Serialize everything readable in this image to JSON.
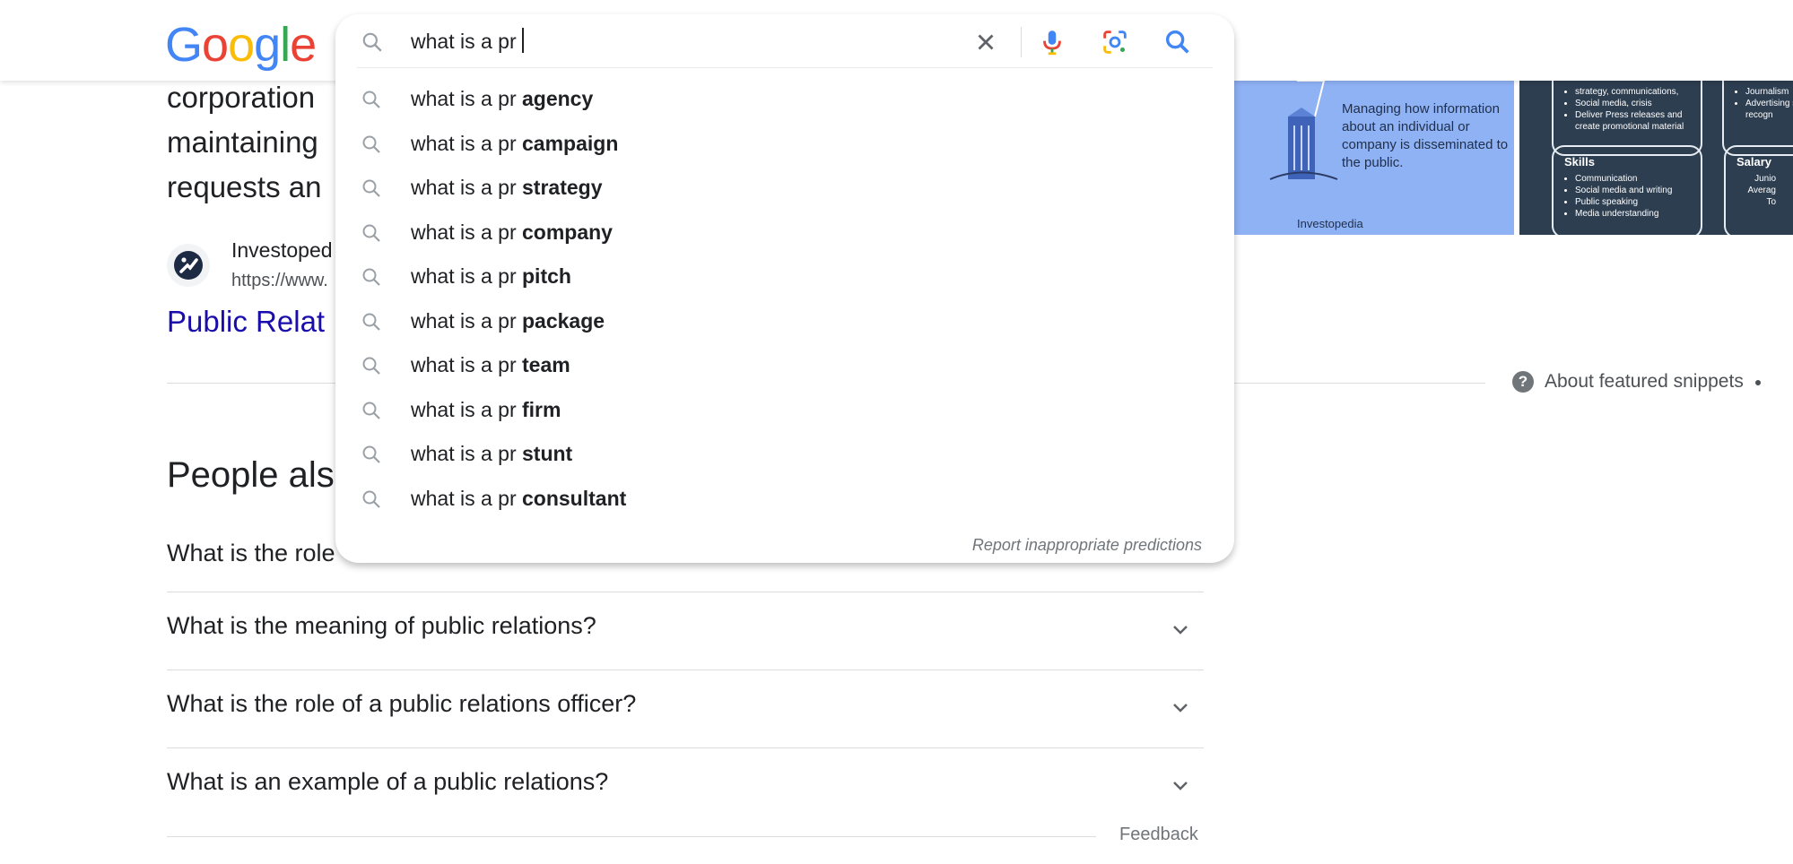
{
  "logo": {
    "letters": [
      "G",
      "o",
      "o",
      "g",
      "l",
      "e"
    ]
  },
  "search": {
    "query": "what is a pr",
    "icons": [
      "search-icon",
      "clear-icon",
      "mic-icon",
      "lens-icon",
      "search-submit-icon"
    ]
  },
  "suggestions": [
    {
      "prefix": "what is a pr ",
      "completion": "agency"
    },
    {
      "prefix": "what is a pr ",
      "completion": "campaign"
    },
    {
      "prefix": "what is a pr ",
      "completion": "strategy"
    },
    {
      "prefix": "what is a pr ",
      "completion": "company"
    },
    {
      "prefix": "what is a pr ",
      "completion": "pitch"
    },
    {
      "prefix": "what is a pr ",
      "completion": "package"
    },
    {
      "prefix": "what is a pr ",
      "completion": "team"
    },
    {
      "prefix": "what is a pr ",
      "completion": "firm"
    },
    {
      "prefix": "what is a pr ",
      "completion": "stunt"
    },
    {
      "prefix": "what is a pr ",
      "completion": "consultant"
    }
  ],
  "report_text": "Report inappropriate predictions",
  "snippet": {
    "lines": [
      "corporation",
      "maintaining",
      "requests an"
    ],
    "source_name": "Investoped",
    "source_url": "https://www.",
    "link_title": "Public Relat"
  },
  "image_card": {
    "caption": "Managing how information about an individual or company is disseminated to the public.",
    "brand": "Investopedia"
  },
  "info_cards": {
    "top_left_items": [
      "strategy, communications,",
      "Social media, crisis",
      "Deliver Press releases and create promotional material"
    ],
    "top_right_items": [
      "Advertising skills recogn",
      "Journalism"
    ],
    "skills_title": "Skills",
    "skills_items": [
      "Communication",
      "Social media and writing",
      "Public speaking",
      "Media understanding"
    ],
    "salary_title": "Salary",
    "salary_items": [
      "Junio",
      "Averag",
      "To"
    ]
  },
  "about_snippets": "About featured snippets",
  "people_also_ask": {
    "title": "People also",
    "partial_question": "What is the role",
    "questions": [
      "What is the meaning of public relations?",
      "What is the role of a public relations officer?",
      "What is an example of a public relations?"
    ]
  },
  "feedback": "Feedback"
}
